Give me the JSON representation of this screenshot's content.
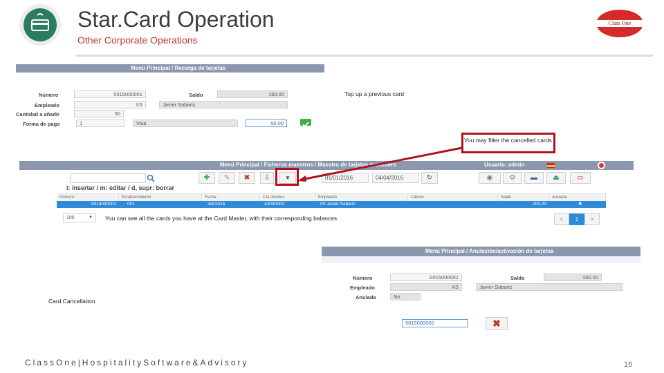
{
  "header": {
    "title": "Star.Card Operation",
    "subtitle": "Other Corporate Operations",
    "brand_text": "Class One"
  },
  "panel1": {
    "breadcrumb": "Menú Principal /  Recarga de tarjetas",
    "numero_label": "Número",
    "numero_value": "0015000001",
    "saldo_label": "Saldo",
    "saldo_value": "150.00",
    "empleado_label": "Empleado",
    "empleado_code": "XS",
    "empleado_name": "Javier Sabariz",
    "cantidad_label": "Cantidad a añadir",
    "cantidad_value": "50",
    "forma_label": "Forma de pago",
    "forma_code": "1",
    "forma_name": "Visa",
    "forma_amount": "50.00",
    "note": "Top up a previous card"
  },
  "panel2": {
    "breadcrumb": "Menú Principal /  Ficheros maestros /  Maestro de tarjetas monedero",
    "user": "Usuario: admin",
    "date_from": "01/01/2016",
    "date_to": "04/04/2016",
    "hint": "i: insertar / m: editar / d, supr: borrar",
    "columns": [
      "Número",
      "Establecimiento",
      "Fecha",
      "Cta clientes",
      "Empleado",
      "Cliente",
      "Saldo",
      "Anulada"
    ],
    "row": [
      "0015000001",
      "001",
      "3/4/2016",
      "43000000",
      "XS   Javier Sabariz",
      "",
      "200.00",
      "✖"
    ],
    "page_size": "100",
    "pager_prev": "<",
    "pager_current": "1",
    "pager_next": ">",
    "callout": "You may filter the cancelled cards",
    "note": "You can see all the cards you have at the Card Master, with their corresponding balances"
  },
  "panel3": {
    "breadcrumb": "Menú Principal /  Anulación/activación de tarjetas",
    "numero_label": "Número",
    "numero_value": "0015000002",
    "saldo_label": "Saldo",
    "saldo_value": "100.00",
    "empleado_label": "Empleado",
    "empleado_code": "XS",
    "empleado_name": "Javier Sabariz",
    "anulada_label": "Anulada",
    "anulada_value": "No",
    "input_value": "0015000002",
    "note": "Card Cancellation"
  },
  "footer": {
    "company": "ClassOne|HospitalitySoftware&Advisory",
    "page": "16"
  },
  "colors": {
    "accent_red": "#c0392b",
    "bar": "#8a97ad",
    "selected_row": "#2f8ad8",
    "callout_border": "#b0121b"
  }
}
